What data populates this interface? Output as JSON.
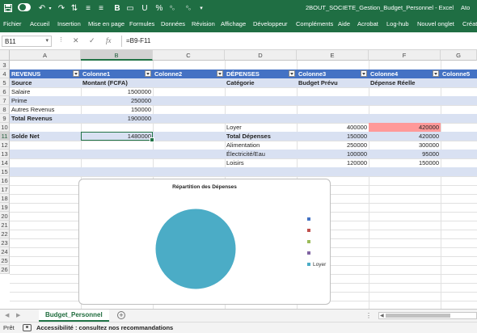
{
  "titlebar": {
    "file_icon": "save-icon",
    "autosave_toggle": "off",
    "doc_title": "2BOUT_SOCIETE_Gestion_Budget_Personnel  -  Excel",
    "account": "Ato"
  },
  "ribbon": {
    "tabs": [
      "Fichier",
      "Accueil",
      "Insertion",
      "Mise en page",
      "Formules",
      "Données",
      "Révision",
      "Affichage",
      "Développeur",
      "Compléments",
      "Aide",
      "Acrobat",
      "Log-hub",
      "Nouvel onglet",
      "Créat"
    ]
  },
  "formula_bar": {
    "name_box": "B11",
    "formula": "=B9-F11",
    "fx_label": "fx"
  },
  "columns": [
    "A",
    "B",
    "C",
    "D",
    "E",
    "F",
    "G"
  ],
  "rows": [
    "3",
    "4",
    "5",
    "6",
    "7",
    "8",
    "9",
    "10",
    "11",
    "12",
    "13",
    "14",
    "15",
    "16",
    "17",
    "18",
    "19",
    "20",
    "21",
    "22",
    "23",
    "24",
    "25",
    "26"
  ],
  "revenus": {
    "header": [
      "REVENUS",
      "Colonne1",
      "Colonne2"
    ],
    "col_labels": [
      "Source",
      "Montant (FCFA)"
    ],
    "rows": [
      {
        "label": "Salaire",
        "value": "1500000"
      },
      {
        "label": "Prime",
        "value": "250000"
      },
      {
        "label": "Autres Revenus",
        "value": "150000"
      },
      {
        "label": "Total Revenus",
        "value": "1900000"
      }
    ],
    "solde_label": "Solde Net",
    "solde_value": "1480000"
  },
  "depenses": {
    "header": [
      "DÉPENSES",
      "Colonne3",
      "Colonne4",
      "Colonne5"
    ],
    "col_labels": [
      "Catégorie",
      "Budget Prévu",
      "Dépense Réelle"
    ],
    "rows": [
      {
        "label": "Loyer",
        "budget": "400000",
        "reel": "420000"
      },
      {
        "label": "Total Dépenses",
        "budget": "150000",
        "reel": "420000"
      },
      {
        "label": "Alimentation",
        "budget": "250000",
        "reel": "300000"
      },
      {
        "label": "Électricité/Eau",
        "budget": "100000",
        "reel": "95000"
      },
      {
        "label": "Loisirs",
        "budget": "120000",
        "reel": "150000"
      }
    ]
  },
  "chart_data": {
    "type": "pie",
    "title": "Répartition des Dépenses",
    "categories": [
      "",
      "",
      "",
      "",
      "Loyer"
    ],
    "values": [
      0,
      0,
      0,
      0,
      400000
    ],
    "colors": [
      "#4472c4",
      "#c0504d",
      "#9bbb59",
      "#8064a2",
      "#4bacc6"
    ],
    "legend_position": "right"
  },
  "sheet_tabs": {
    "active": "Budget_Personnel",
    "add_label": "+"
  },
  "statusbar": {
    "ready": "Prêt",
    "accessibility": "Accessibilité : consultez nos recommandations"
  }
}
